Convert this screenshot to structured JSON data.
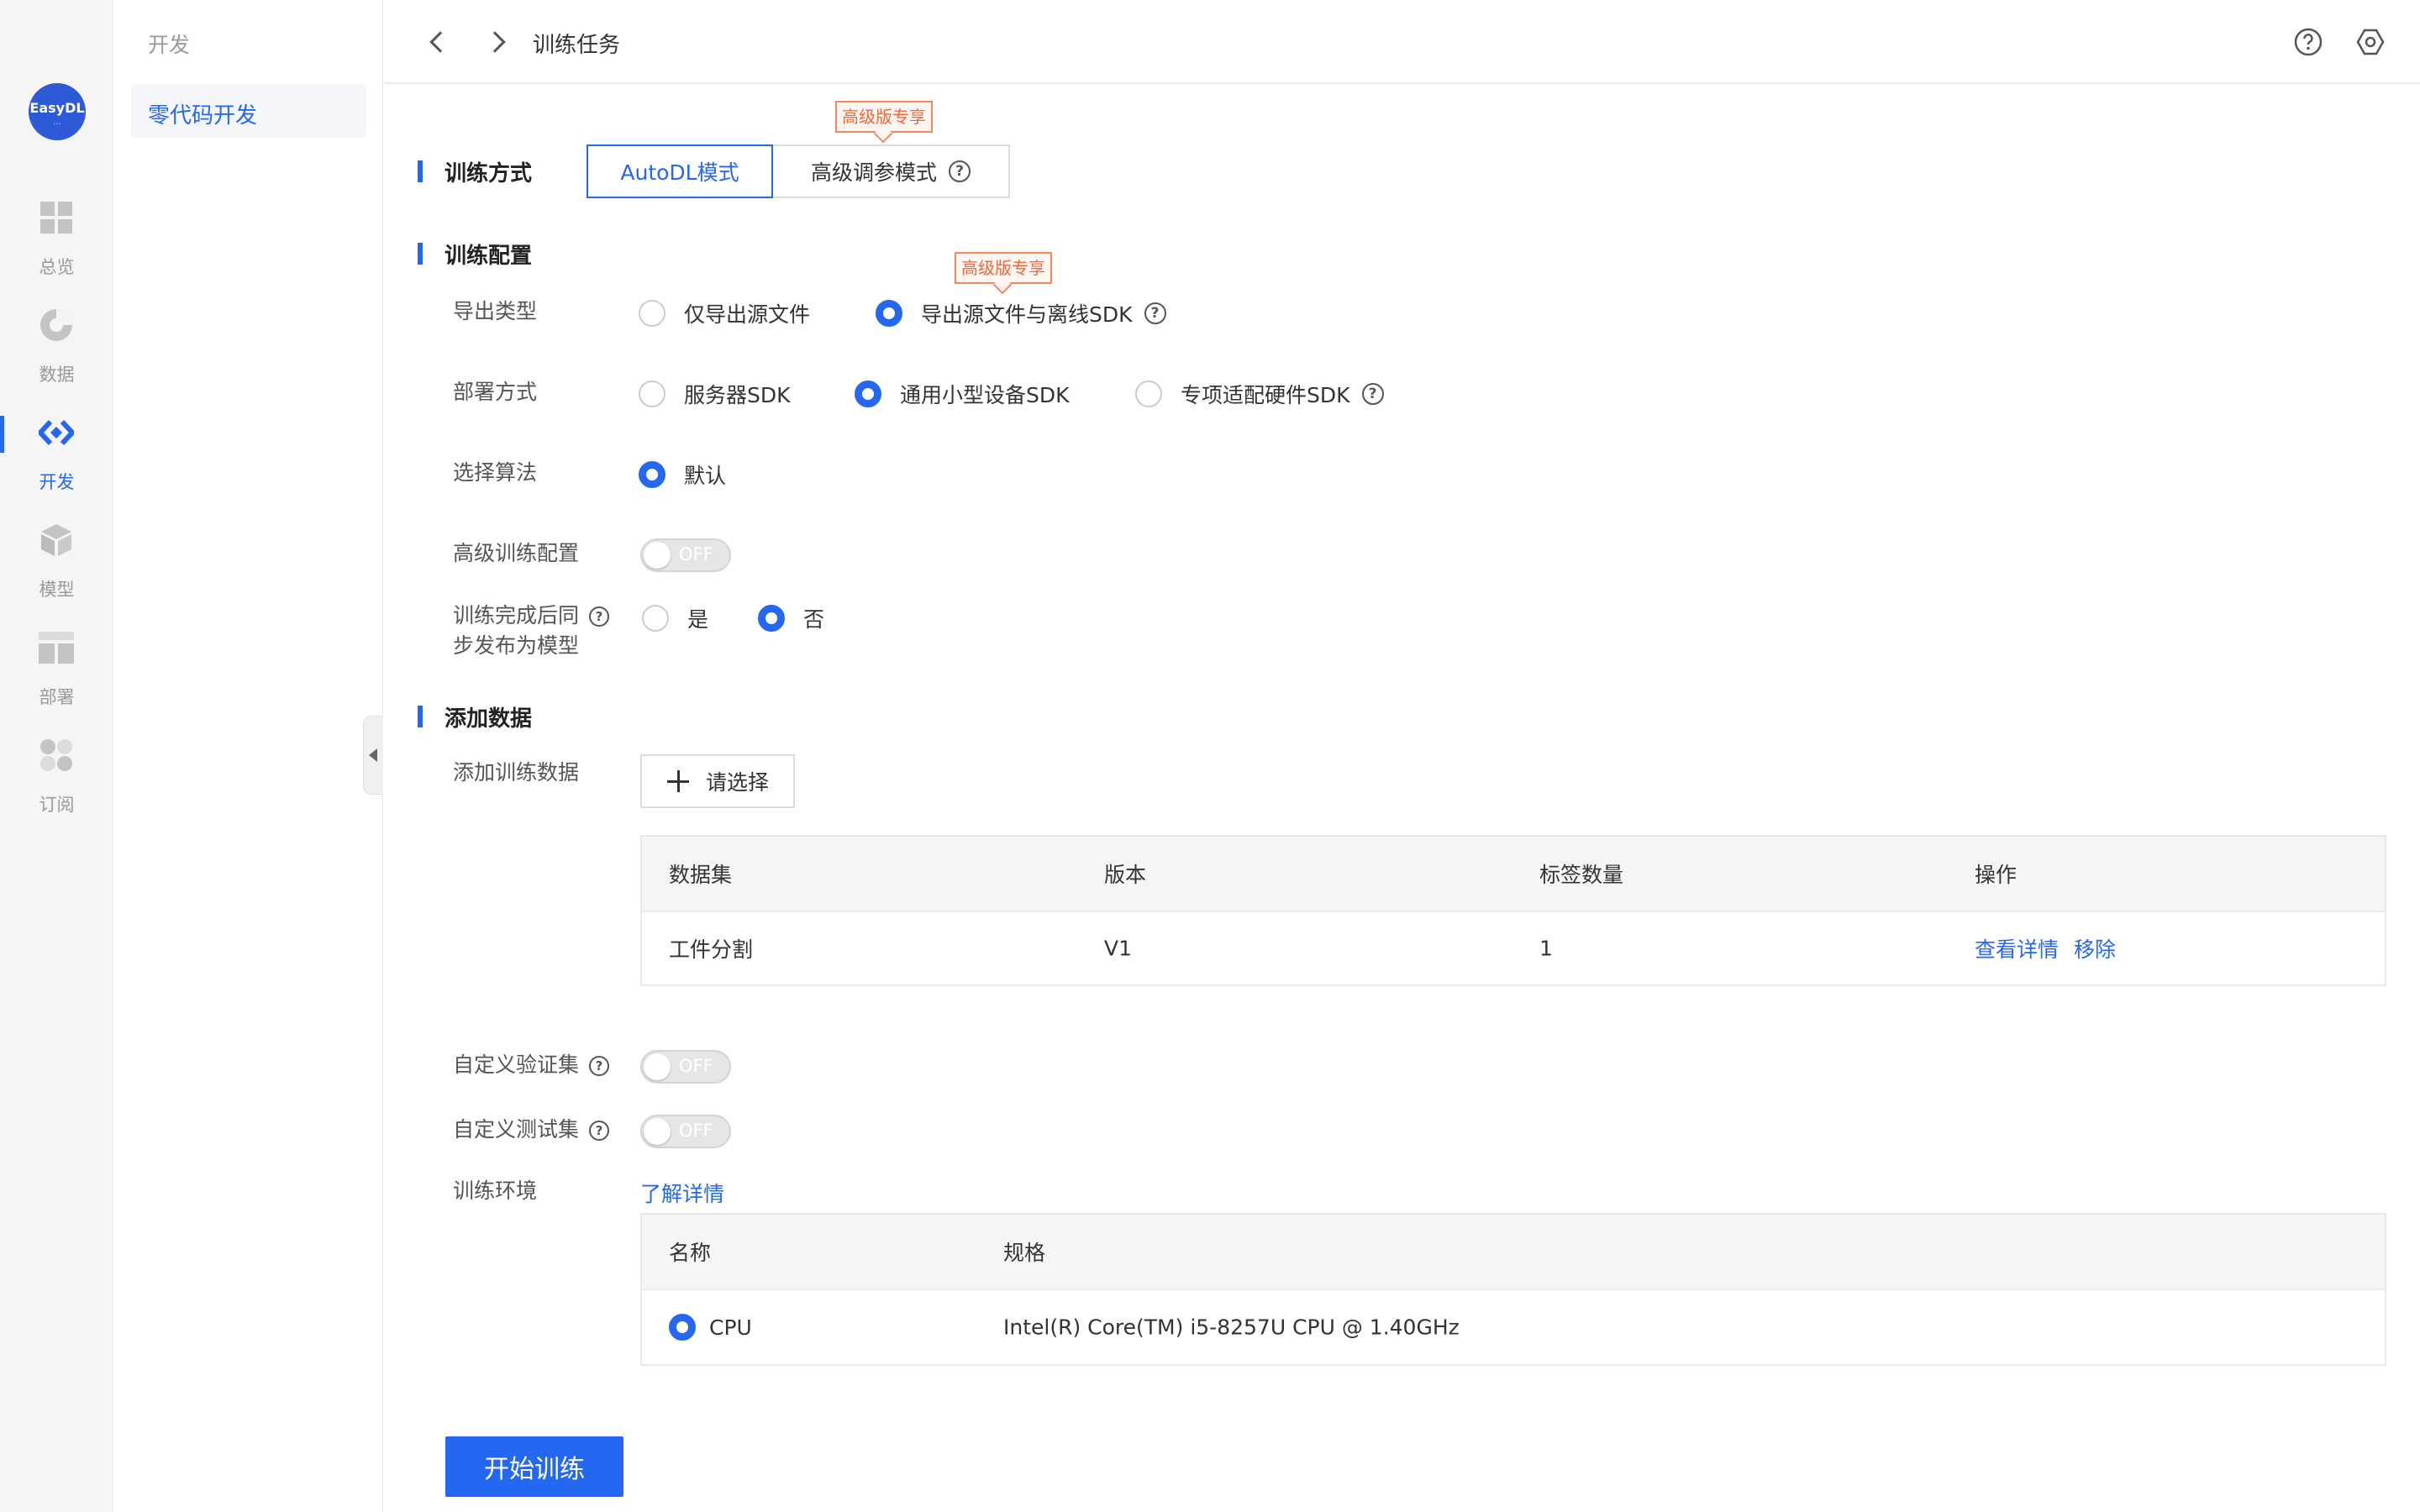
{
  "rail": {
    "logo_text": "EasyDL",
    "logo_sub": "···",
    "items": [
      {
        "label": "总览",
        "icon": "grid-icon"
      },
      {
        "label": "数据",
        "icon": "pie-icon"
      },
      {
        "label": "开发",
        "icon": "code-icon",
        "active": true
      },
      {
        "label": "模型",
        "icon": "cube-icon"
      },
      {
        "label": "部署",
        "icon": "layout-icon"
      },
      {
        "label": "订阅",
        "icon": "subscribe-icon"
      }
    ]
  },
  "subnav": {
    "title": "开发",
    "active_item": "零代码开发"
  },
  "topbar": {
    "title": "训练任务",
    "icons": [
      "back-icon",
      "forward-icon",
      "help-icon",
      "settings-icon"
    ]
  },
  "training_method": {
    "title": "训练方式",
    "options": [
      "AutoDL模式",
      "高级调参模式"
    ],
    "selected": "AutoDL模式",
    "premium_badge": "高级版专享"
  },
  "training_config": {
    "title": "训练配置",
    "export_type": {
      "label": "导出类型",
      "options": [
        "仅导出源文件",
        "导出源文件与离线SDK"
      ],
      "selected": "导出源文件与离线SDK",
      "premium_badge": "高级版专享"
    },
    "deploy_method": {
      "label": "部署方式",
      "options": [
        "服务器SDK",
        "通用小型设备SDK",
        "专项适配硬件SDK"
      ],
      "selected": "通用小型设备SDK"
    },
    "algorithm": {
      "label": "选择算法",
      "options": [
        "默认"
      ],
      "selected": "默认"
    },
    "advanced": {
      "label": "高级训练配置",
      "toggle": "OFF"
    },
    "publish": {
      "label_line1": "训练完成后同",
      "label_line2": "步发布为模型",
      "options": [
        "是",
        "否"
      ],
      "selected": "否"
    }
  },
  "add_data": {
    "title": "添加数据",
    "label": "添加训练数据",
    "select_button": "请选择",
    "columns": [
      "数据集",
      "版本",
      "标签数量",
      "操作"
    ],
    "rows": [
      {
        "dataset": "工件分割",
        "version": "V1",
        "label_count": "1",
        "actions": [
          "查看详情",
          "移除"
        ]
      }
    ]
  },
  "custom": {
    "validation_label": "自定义验证集",
    "validation_toggle": "OFF",
    "test_label": "自定义测试集",
    "test_toggle": "OFF"
  },
  "environment": {
    "label": "训练环境",
    "learn_more": "了解详情",
    "columns": [
      "名称",
      "规格"
    ],
    "rows": [
      {
        "name": "CPU",
        "spec": "Intel(R) Core(TM) i5-8257U CPU @ 1.40GHz",
        "selected": true
      }
    ]
  },
  "start_button": "开始训练",
  "colors": {
    "accent": "#2468f2",
    "badge": "#f0683a",
    "rail_bg": "#f5f5f5"
  }
}
